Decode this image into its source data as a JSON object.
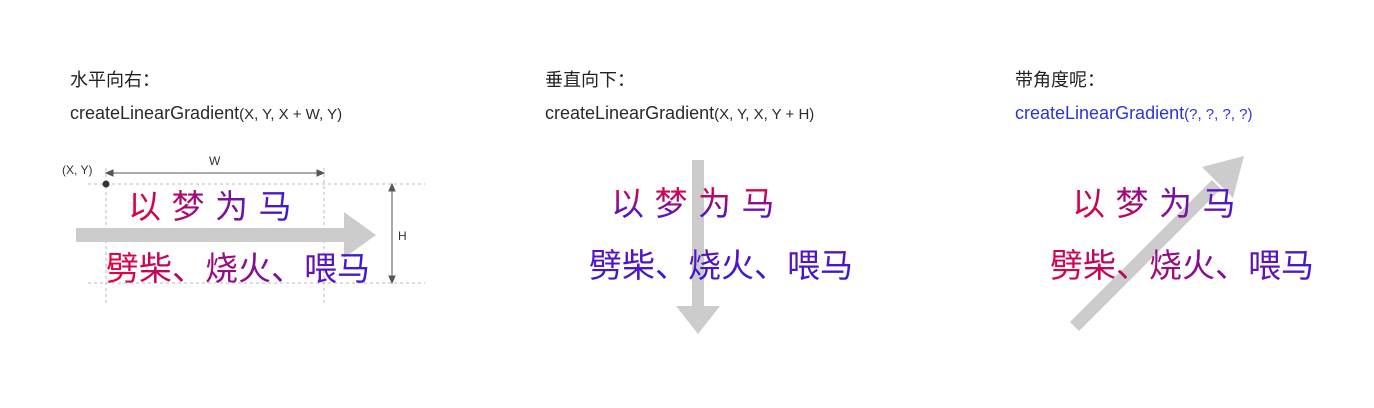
{
  "panels": [
    {
      "heading": "水平向右：",
      "code_fn": "createLinearGradient",
      "code_args": "(X, Y, X + W, Y)",
      "text_line1": "以 梦 为 马",
      "text_line2": "劈柴、烧火、喂马",
      "label_xy": "(X, Y)",
      "label_w": "W",
      "label_h": "H",
      "gradient_direction": "horizontal"
    },
    {
      "heading": "垂直向下：",
      "code_fn": "createLinearGradient",
      "code_args": "(X, Y, X, Y + H)",
      "text_line1": "以 梦 为 马",
      "text_line2": "劈柴、烧火、喂马",
      "gradient_direction": "vertical"
    },
    {
      "heading": "带角度呢：",
      "code_fn": "createLinearGradient",
      "code_args": "(?, ?, ?, ?)",
      "text_line1": "以 梦 为 马",
      "text_line2": "劈柴、烧火、喂马",
      "gradient_direction": "diagonal"
    }
  ],
  "colors": {
    "gradient_start": "#e8003c",
    "gradient_end": "#3a1ad8",
    "arrow": "#cccccc",
    "code_highlight": "#2a35d8"
  }
}
